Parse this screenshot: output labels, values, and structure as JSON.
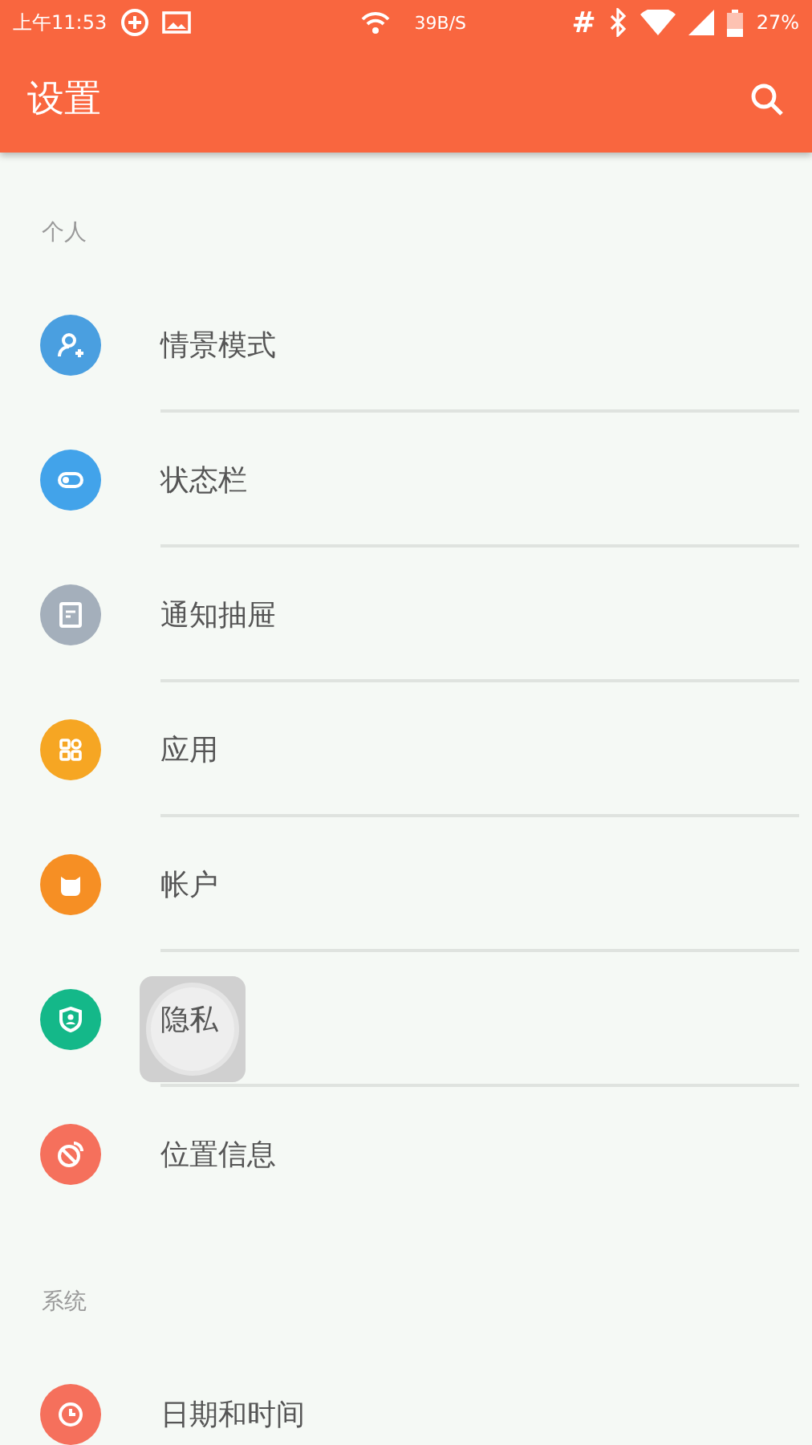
{
  "status_bar": {
    "time": "上午11:53",
    "speed": "39B/S",
    "hash": "#",
    "battery": "27%"
  },
  "app_bar": {
    "title": "设置"
  },
  "sections": [
    {
      "header": "个人",
      "items": [
        {
          "label": "情景模式",
          "kind": "profile",
          "color": "#4a9fe0",
          "pressed": false
        },
        {
          "label": "状态栏",
          "kind": "toggle",
          "color": "#42a3ea",
          "pressed": false
        },
        {
          "label": "通知抽屉",
          "kind": "note",
          "color": "#a4afbb",
          "pressed": false
        },
        {
          "label": "应用",
          "kind": "apps",
          "color": "#f6a623",
          "pressed": false
        },
        {
          "label": "帐户",
          "kind": "account",
          "color": "#f68f24",
          "pressed": false
        },
        {
          "label": "隐私",
          "kind": "shield",
          "color": "#14b889",
          "pressed": true
        },
        {
          "label": "位置信息",
          "kind": "location",
          "color": "#f5705c",
          "pressed": false
        }
      ]
    },
    {
      "header": "系统",
      "items": [
        {
          "label": "日期和时间",
          "kind": "clock",
          "color": "#f5705c",
          "pressed": false
        }
      ]
    }
  ]
}
